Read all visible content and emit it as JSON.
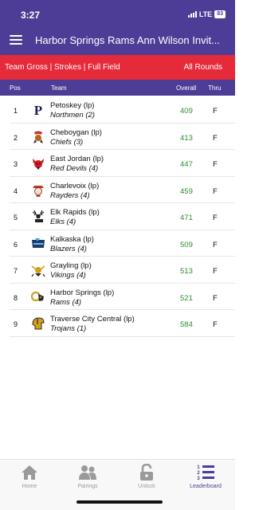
{
  "status_bar": {
    "time": "3:27",
    "network": "LTE",
    "battery": "83"
  },
  "header": {
    "title": "Harbor Springs Rams Ann Wilson Invit..."
  },
  "filter_bar": {
    "left_label": "Team Gross | Strokes | Full Field",
    "right_label": "All Rounds"
  },
  "columns": {
    "pos": "Pos",
    "team": "Team",
    "overall": "Overall",
    "thru": "Thru"
  },
  "rows": [
    {
      "pos": "1",
      "team": "Petoskey (lp)",
      "mascot": "Northmen (2)",
      "overall": "409",
      "thru": "F",
      "logo": "petoskey-p-logo"
    },
    {
      "pos": "2",
      "team": "Cheboygan (lp)",
      "mascot": "Chiefs (3)",
      "overall": "413",
      "thru": "F",
      "logo": "chiefs-logo"
    },
    {
      "pos": "3",
      "team": "East Jordan (lp)",
      "mascot": "Red Devils (4)",
      "overall": "447",
      "thru": "F",
      "logo": "red-devil-logo"
    },
    {
      "pos": "4",
      "team": "Charlevoix (lp)",
      "mascot": "Rayders (4)",
      "overall": "459",
      "thru": "F",
      "logo": "rayders-logo"
    },
    {
      "pos": "5",
      "team": "Elk Rapids (lp)",
      "mascot": "Elks (4)",
      "overall": "471",
      "thru": "F",
      "logo": "elk-logo"
    },
    {
      "pos": "6",
      "team": "Kalkaska (lp)",
      "mascot": "Blazers (4)",
      "overall": "509",
      "thru": "F",
      "logo": "blazers-logo"
    },
    {
      "pos": "7",
      "team": "Grayling (lp)",
      "mascot": "Vikings (4)",
      "overall": "513",
      "thru": "F",
      "logo": "vikings-logo"
    },
    {
      "pos": "8",
      "team": "Harbor Springs (lp)",
      "mascot": "Rams (4)",
      "overall": "521",
      "thru": "F",
      "logo": "ram-logo"
    },
    {
      "pos": "9",
      "team": "Traverse City Central (lp)",
      "mascot": "Trojans (1)",
      "overall": "584",
      "thru": "F",
      "logo": "trojan-logo"
    }
  ],
  "bottom_nav": {
    "home": "Home",
    "pairings": "Pairings",
    "unlock": "Unlock",
    "leaderboard": "Leaderboard"
  },
  "colors": {
    "header": "#4e3d96",
    "filter_bar": "#e52a3a",
    "score": "#2e8b2e",
    "nav_inactive": "#9a9a9a"
  }
}
